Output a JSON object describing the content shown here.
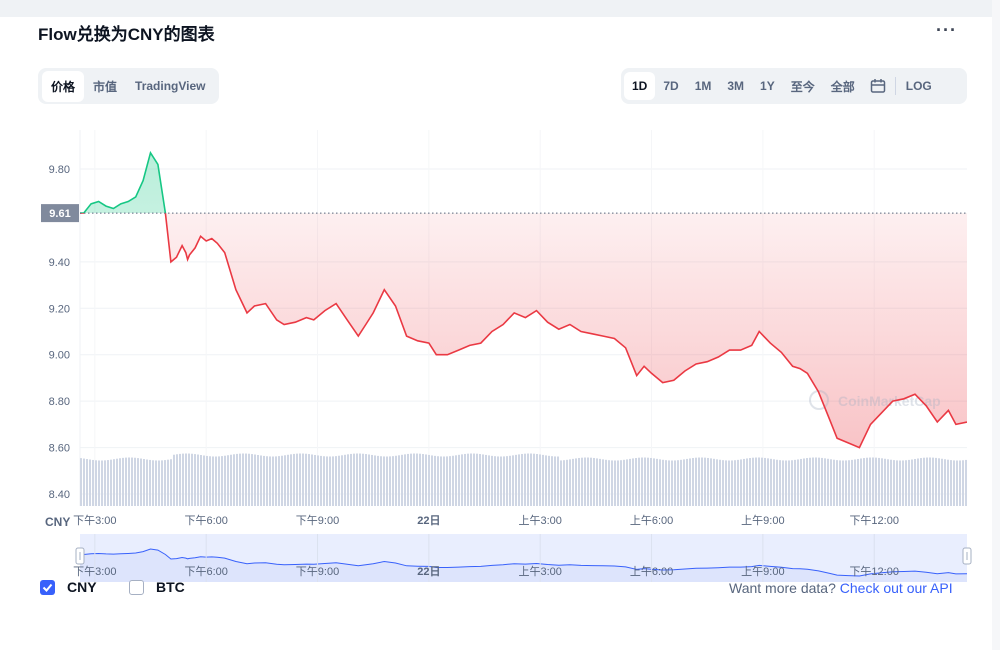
{
  "title": "Flow兑换为CNY的图表",
  "more_icon": "more-dots-icon",
  "tabs": [
    {
      "label": "价格",
      "active": true
    },
    {
      "label": "市值",
      "active": false
    },
    {
      "label": "TradingView",
      "active": false
    }
  ],
  "ranges": [
    {
      "label": "1D",
      "active": true
    },
    {
      "label": "7D",
      "active": false
    },
    {
      "label": "1M",
      "active": false
    },
    {
      "label": "3M",
      "active": false
    },
    {
      "label": "1Y",
      "active": false
    },
    {
      "label": "至今",
      "active": false
    },
    {
      "label": "全部",
      "active": false
    }
  ],
  "calendar_icon": "calendar-icon",
  "log_label": "LOG",
  "chart_data": {
    "type": "line",
    "currency_label": "CNY",
    "y_ticks": [
      "9.80",
      "9.40",
      "9.20",
      "9.00",
      "8.80",
      "8.60",
      "8.40"
    ],
    "ylim": [
      8.4,
      9.9
    ],
    "open_price": 9.61,
    "open_price_label": "9.61",
    "x_tick_labels": [
      "下午3:00",
      "下午6:00",
      "下午9:00",
      "22日",
      "上午3:00",
      "上午6:00",
      "上午9:00",
      "下午12:00"
    ],
    "x_range_hours": [
      14.6,
      38.5
    ],
    "x_tick_hours": [
      15,
      18,
      21,
      24,
      27,
      30,
      33,
      36
    ],
    "series": [
      {
        "x": [
          14.6,
          14.7,
          14.9,
          15.1,
          15.3,
          15.5,
          15.7,
          15.9,
          16.1,
          16.3,
          16.5,
          16.7,
          16.9,
          17.05,
          17.2,
          17.35,
          17.45,
          17.5,
          17.55,
          17.7,
          17.85,
          18.0,
          18.15,
          18.3,
          18.5,
          18.8,
          19.1,
          19.3,
          19.6,
          19.9,
          20.1,
          20.4,
          20.7,
          20.9,
          21.2,
          21.5,
          21.8,
          22.1,
          22.3,
          22.5,
          22.8,
          23.1,
          23.4,
          23.7,
          24.0,
          24.2,
          24.5,
          24.8,
          25.1,
          25.4,
          25.7,
          26.0,
          26.3,
          26.6,
          26.9,
          27.2,
          27.5,
          27.8,
          28.1,
          28.4,
          28.7,
          29.0,
          29.3,
          29.6,
          29.8,
          30.0,
          30.3,
          30.6,
          30.9,
          31.2,
          31.5,
          31.8,
          32.1,
          32.4,
          32.7,
          32.9,
          33.2,
          33.5,
          33.8,
          34.0,
          34.2,
          34.5,
          34.8,
          35.0,
          35.3,
          35.6,
          35.9,
          36.2,
          36.5,
          36.8,
          37.1,
          37.4,
          37.7,
          38.0,
          38.2,
          38.5
        ],
        "values": [
          9.61,
          9.61,
          9.65,
          9.66,
          9.64,
          9.63,
          9.65,
          9.66,
          9.68,
          9.75,
          9.87,
          9.82,
          9.61,
          9.4,
          9.42,
          9.47,
          9.44,
          9.41,
          9.43,
          9.46,
          9.51,
          9.49,
          9.5,
          9.48,
          9.44,
          9.28,
          9.18,
          9.21,
          9.22,
          9.15,
          9.13,
          9.14,
          9.16,
          9.15,
          9.19,
          9.22,
          9.15,
          9.08,
          9.13,
          9.18,
          9.28,
          9.21,
          9.08,
          9.06,
          9.05,
          9.0,
          9.0,
          9.02,
          9.04,
          9.05,
          9.1,
          9.13,
          9.18,
          9.16,
          9.19,
          9.14,
          9.11,
          9.13,
          9.1,
          9.09,
          9.08,
          9.07,
          9.03,
          8.91,
          8.95,
          8.92,
          8.88,
          8.89,
          8.93,
          8.96,
          8.97,
          8.99,
          9.02,
          9.02,
          9.04,
          9.1,
          9.05,
          9.01,
          8.95,
          8.94,
          8.92,
          8.84,
          8.72,
          8.64,
          8.62,
          8.6,
          8.7,
          8.75,
          8.8,
          8.81,
          8.83,
          8.78,
          8.71,
          8.76,
          8.7,
          8.71
        ]
      }
    ],
    "volume_note": "gray volume bars along bottom",
    "navigator_labels": [
      "下午3:00",
      "下午6:00",
      "下午9:00",
      "22日",
      "上午3:00",
      "上午6:00",
      "上午9:00",
      "下午12:00"
    ],
    "watermark": "CoinMarketCap",
    "colors": {
      "up": "#16c784",
      "down": "#ea3943",
      "volume": "#cfd6e4",
      "navigator": "#3861fb"
    }
  },
  "legend": {
    "cny_label": "CNY",
    "cny_checked": true,
    "btc_label": "BTC",
    "btc_checked": false
  },
  "footer": {
    "prompt": "Want more data?",
    "link": "Check out our API"
  }
}
